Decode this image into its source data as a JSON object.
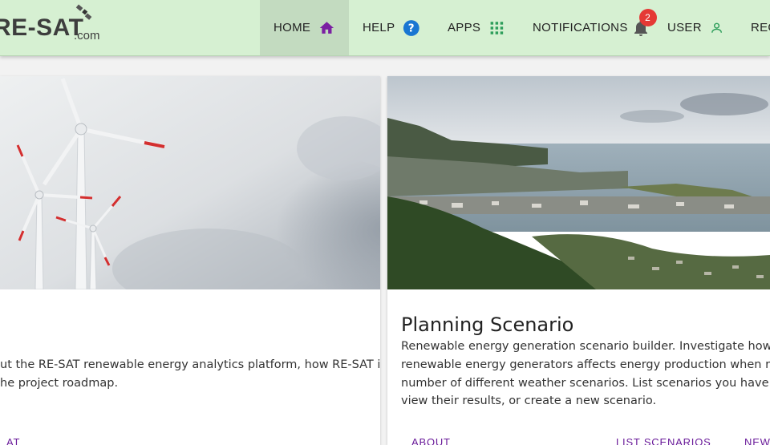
{
  "header": {
    "logo_text": "RE-SAT",
    "logo_domain": ".com",
    "nav": [
      {
        "label": "HOME",
        "icon": "home-icon"
      },
      {
        "label": "HELP",
        "icon": "help-icon"
      },
      {
        "label": "APPS",
        "icon": "apps-grid-icon"
      },
      {
        "label": "NOTIFICATIONS",
        "icon": "bell-icon",
        "badge": "2"
      },
      {
        "label": "USER",
        "icon": "user-icon"
      },
      {
        "label": "REG",
        "icon": ""
      }
    ]
  },
  "cards": [
    {
      "image": "wind-turbines-image",
      "title": "",
      "lines": [
        "ut the RE-SAT renewable energy analytics platform, how RE-SAT is",
        "he project roadmap."
      ],
      "actions": [
        "AT",
        ""
      ]
    },
    {
      "image": "island-coastline-image",
      "title": "Planning Scenario",
      "lines": [
        "Renewable energy generation scenario builder. Investigate how the loc",
        "renewable energy generators affects energy production when run agai",
        "number of different weather scenarios. List scenarios you have create",
        "view their results, or create a new scenario."
      ],
      "actions": [
        "ABOUT",
        "LIST SCENARIOS",
        "NEW"
      ]
    }
  ],
  "colors": {
    "header_bg": "#d6f0d2",
    "home_icon": "#7b1fa2",
    "help_icon": "#1976d2",
    "apps_icon": "#2e9e5b",
    "user_icon": "#2e9e5b",
    "badge": "#e53935"
  }
}
